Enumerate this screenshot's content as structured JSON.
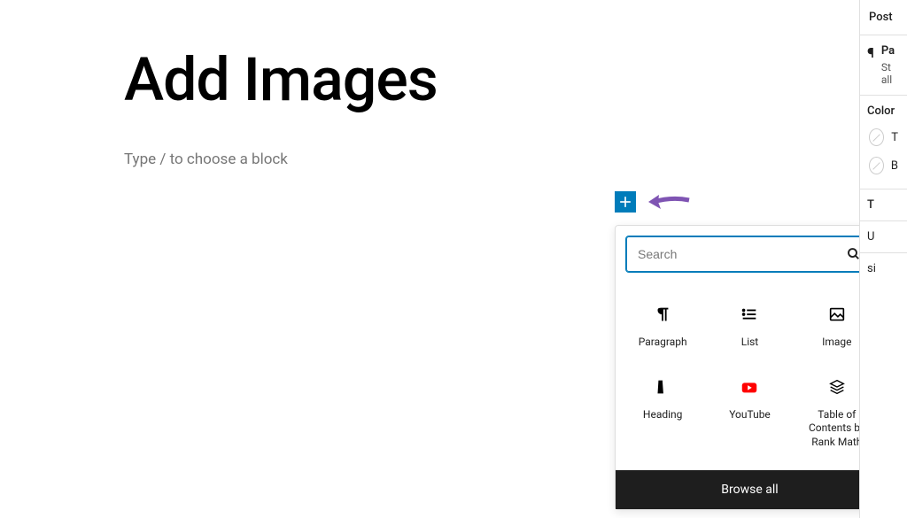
{
  "editor": {
    "title": "Add Images",
    "placeholder": "Type / to choose a block"
  },
  "inserter": {
    "search_placeholder": "Search",
    "blocks": [
      {
        "label": "Paragraph"
      },
      {
        "label": "List"
      },
      {
        "label": "Image"
      },
      {
        "label": "Heading"
      },
      {
        "label": "YouTube"
      },
      {
        "label": "Table of Contents by Rank Math"
      }
    ],
    "browse_all": "Browse all"
  },
  "sidebar": {
    "tab": "Post",
    "block_label": "Pa",
    "block_desc_line1": "St",
    "block_desc_line2": "all",
    "color_heading": "Color",
    "color_text": "T",
    "color_bg": "B",
    "typography": "T",
    "usage": "U",
    "size": "si"
  },
  "colors": {
    "accent": "#007cba",
    "arrow": "#7f54b3",
    "youtube": "#ff0000"
  }
}
